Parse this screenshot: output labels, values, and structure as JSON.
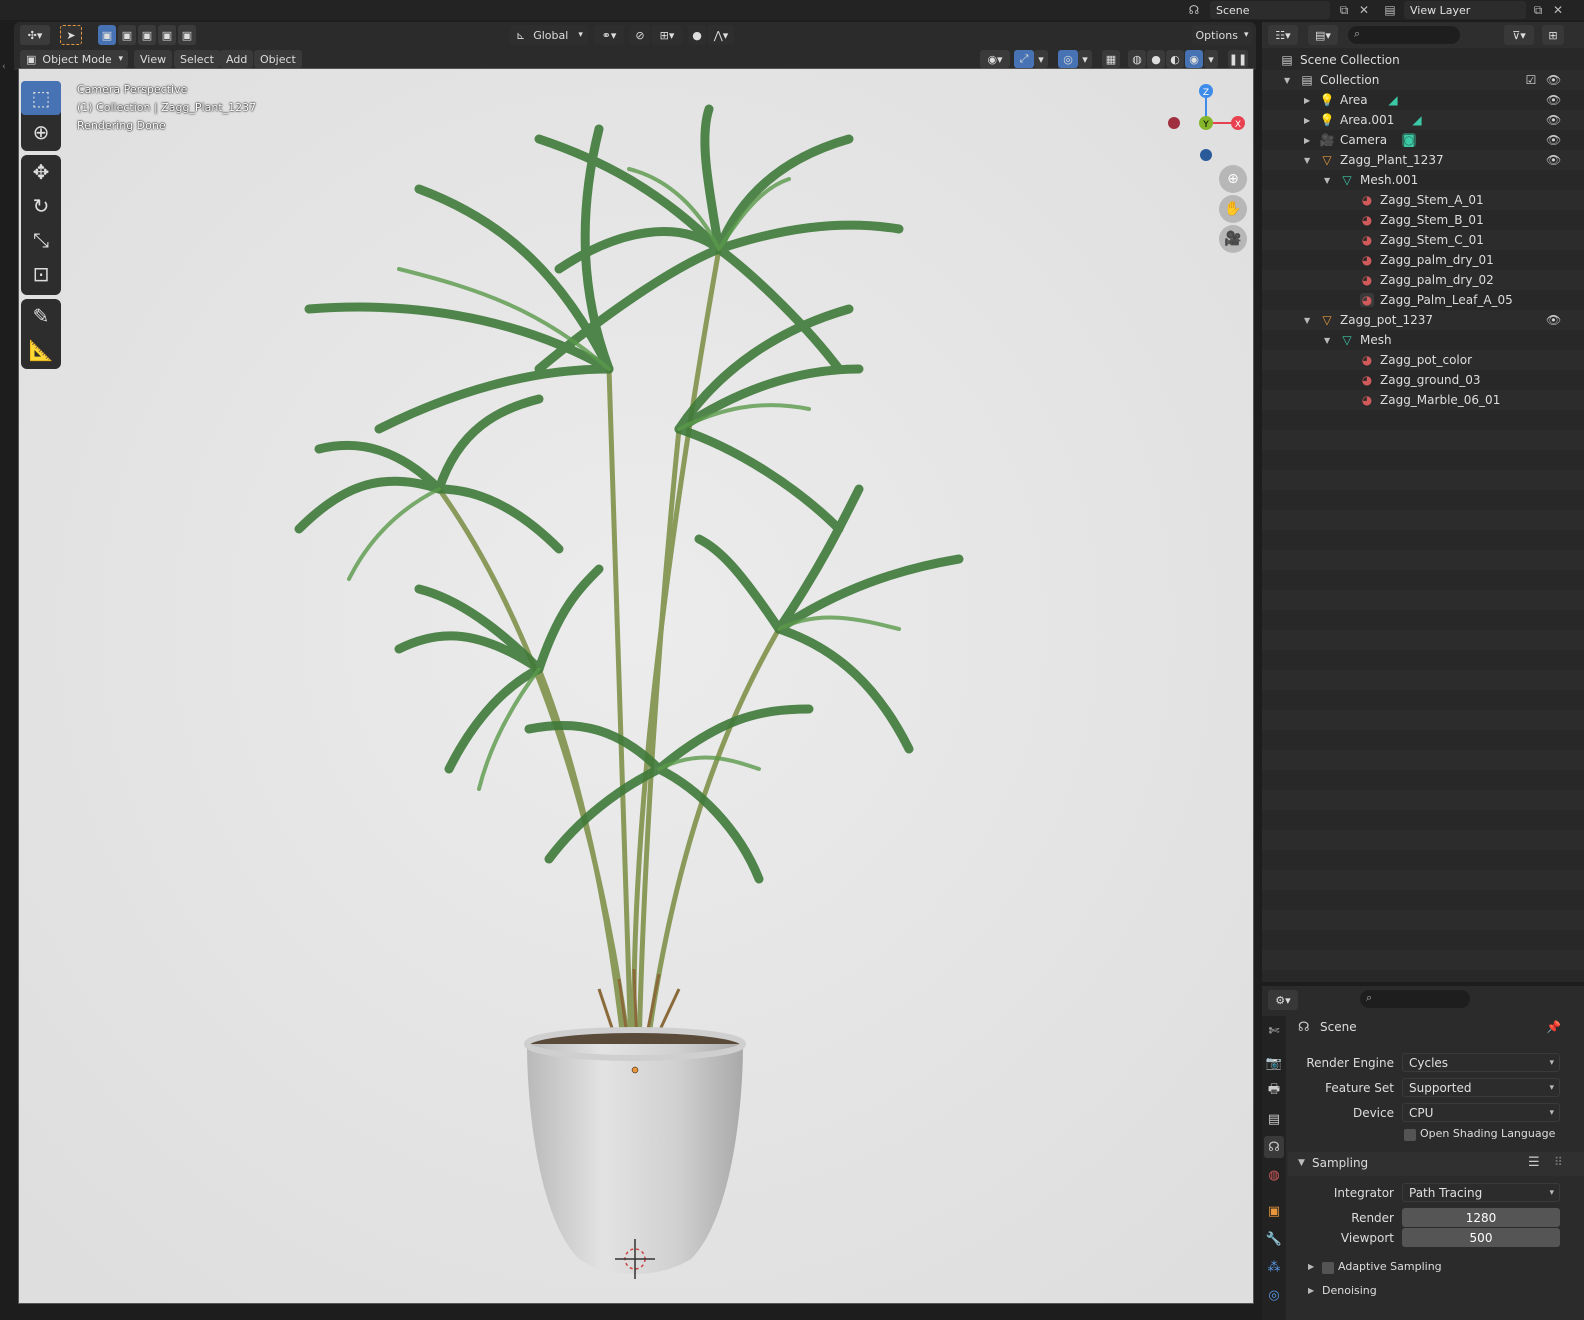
{
  "topbar": {
    "scene_label": "Scene",
    "view_layer_label": "View Layer"
  },
  "viewport_header": {
    "transform_orientation": "Global",
    "options_label": "Options",
    "mode_label": "Object Mode",
    "menus": [
      "View",
      "Select",
      "Add",
      "Object"
    ]
  },
  "viewport": {
    "info_line1": "Camera Perspective",
    "info_line2": "(1) Collection | Zagg_Plant_1237",
    "info_line3": "Rendering Done",
    "gizmo": {
      "z": "Z",
      "y": "Y",
      "x": "X"
    }
  },
  "outliner": {
    "rows": [
      {
        "label": "Scene Collection",
        "icon": "scene-collection-icon"
      },
      {
        "label": "Collection",
        "icon": "collection-icon"
      },
      {
        "label": "Area",
        "icon": "light-icon"
      },
      {
        "label": "Area.001",
        "icon": "light-icon"
      },
      {
        "label": "Camera",
        "icon": "camera-icon"
      },
      {
        "label": "Zagg_Plant_1237",
        "icon": "mesh-object-icon"
      },
      {
        "label": "Mesh.001",
        "icon": "mesh-data-icon"
      },
      {
        "label": "Zagg_Stem_A_01",
        "icon": "material-icon"
      },
      {
        "label": "Zagg_Stem_B_01",
        "icon": "material-icon"
      },
      {
        "label": "Zagg_Stem_C_01",
        "icon": "material-icon"
      },
      {
        "label": "Zagg_palm_dry_01",
        "icon": "material-icon"
      },
      {
        "label": "Zagg_palm_dry_02",
        "icon": "material-icon"
      },
      {
        "label": "Zagg_Palm_Leaf_A_05",
        "icon": "material-icon"
      },
      {
        "label": "Zagg_pot_1237",
        "icon": "mesh-object-icon"
      },
      {
        "label": "Mesh",
        "icon": "mesh-data-icon"
      },
      {
        "label": "Zagg_pot_color",
        "icon": "material-icon"
      },
      {
        "label": "Zagg_ground_03",
        "icon": "material-icon"
      },
      {
        "label": "Zagg_Marble_06_01",
        "icon": "material-icon"
      }
    ]
  },
  "properties": {
    "context_label": "Scene",
    "render_engine_label": "Render Engine",
    "render_engine_value": "Cycles",
    "feature_set_label": "Feature Set",
    "feature_set_value": "Supported",
    "device_label": "Device",
    "device_value": "CPU",
    "osl_label": "Open Shading Language",
    "sampling_label": "Sampling",
    "integrator_label": "Integrator",
    "integrator_value": "Path Tracing",
    "render_label": "Render",
    "render_value": "1280",
    "viewport_label": "Viewport",
    "viewport_value": "500",
    "adaptive_label": "Adaptive Sampling",
    "denoising_label": "Denoising"
  },
  "colors": {
    "accent": "#4772b3",
    "viewport_bg": "#e4e4e4",
    "axis_x": "#e8414f",
    "axis_y": "#84b52b",
    "axis_z": "#3d8bea",
    "light_icon": "#e8973c",
    "mesh_icon": "#3cc9a6",
    "material_icon": "#d25a5a"
  }
}
